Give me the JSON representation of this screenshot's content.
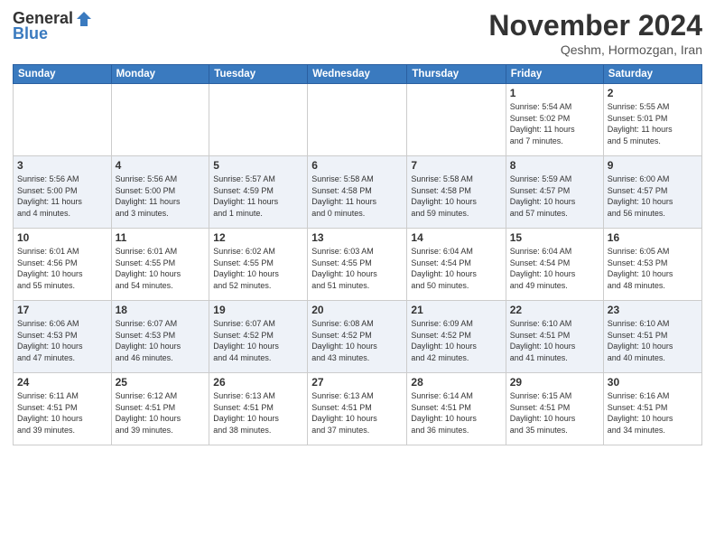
{
  "header": {
    "logo_general": "General",
    "logo_blue": "Blue",
    "title": "November 2024",
    "location": "Qeshm, Hormozgan, Iran"
  },
  "days_of_week": [
    "Sunday",
    "Monday",
    "Tuesday",
    "Wednesday",
    "Thursday",
    "Friday",
    "Saturday"
  ],
  "weeks": [
    [
      {
        "day": "",
        "info": ""
      },
      {
        "day": "",
        "info": ""
      },
      {
        "day": "",
        "info": ""
      },
      {
        "day": "",
        "info": ""
      },
      {
        "day": "",
        "info": ""
      },
      {
        "day": "1",
        "info": "Sunrise: 5:54 AM\nSunset: 5:02 PM\nDaylight: 11 hours\nand 7 minutes."
      },
      {
        "day": "2",
        "info": "Sunrise: 5:55 AM\nSunset: 5:01 PM\nDaylight: 11 hours\nand 5 minutes."
      }
    ],
    [
      {
        "day": "3",
        "info": "Sunrise: 5:56 AM\nSunset: 5:00 PM\nDaylight: 11 hours\nand 4 minutes."
      },
      {
        "day": "4",
        "info": "Sunrise: 5:56 AM\nSunset: 5:00 PM\nDaylight: 11 hours\nand 3 minutes."
      },
      {
        "day": "5",
        "info": "Sunrise: 5:57 AM\nSunset: 4:59 PM\nDaylight: 11 hours\nand 1 minute."
      },
      {
        "day": "6",
        "info": "Sunrise: 5:58 AM\nSunset: 4:58 PM\nDaylight: 11 hours\nand 0 minutes."
      },
      {
        "day": "7",
        "info": "Sunrise: 5:58 AM\nSunset: 4:58 PM\nDaylight: 10 hours\nand 59 minutes."
      },
      {
        "day": "8",
        "info": "Sunrise: 5:59 AM\nSunset: 4:57 PM\nDaylight: 10 hours\nand 57 minutes."
      },
      {
        "day": "9",
        "info": "Sunrise: 6:00 AM\nSunset: 4:57 PM\nDaylight: 10 hours\nand 56 minutes."
      }
    ],
    [
      {
        "day": "10",
        "info": "Sunrise: 6:01 AM\nSunset: 4:56 PM\nDaylight: 10 hours\nand 55 minutes."
      },
      {
        "day": "11",
        "info": "Sunrise: 6:01 AM\nSunset: 4:55 PM\nDaylight: 10 hours\nand 54 minutes."
      },
      {
        "day": "12",
        "info": "Sunrise: 6:02 AM\nSunset: 4:55 PM\nDaylight: 10 hours\nand 52 minutes."
      },
      {
        "day": "13",
        "info": "Sunrise: 6:03 AM\nSunset: 4:55 PM\nDaylight: 10 hours\nand 51 minutes."
      },
      {
        "day": "14",
        "info": "Sunrise: 6:04 AM\nSunset: 4:54 PM\nDaylight: 10 hours\nand 50 minutes."
      },
      {
        "day": "15",
        "info": "Sunrise: 6:04 AM\nSunset: 4:54 PM\nDaylight: 10 hours\nand 49 minutes."
      },
      {
        "day": "16",
        "info": "Sunrise: 6:05 AM\nSunset: 4:53 PM\nDaylight: 10 hours\nand 48 minutes."
      }
    ],
    [
      {
        "day": "17",
        "info": "Sunrise: 6:06 AM\nSunset: 4:53 PM\nDaylight: 10 hours\nand 47 minutes."
      },
      {
        "day": "18",
        "info": "Sunrise: 6:07 AM\nSunset: 4:53 PM\nDaylight: 10 hours\nand 46 minutes."
      },
      {
        "day": "19",
        "info": "Sunrise: 6:07 AM\nSunset: 4:52 PM\nDaylight: 10 hours\nand 44 minutes."
      },
      {
        "day": "20",
        "info": "Sunrise: 6:08 AM\nSunset: 4:52 PM\nDaylight: 10 hours\nand 43 minutes."
      },
      {
        "day": "21",
        "info": "Sunrise: 6:09 AM\nSunset: 4:52 PM\nDaylight: 10 hours\nand 42 minutes."
      },
      {
        "day": "22",
        "info": "Sunrise: 6:10 AM\nSunset: 4:51 PM\nDaylight: 10 hours\nand 41 minutes."
      },
      {
        "day": "23",
        "info": "Sunrise: 6:10 AM\nSunset: 4:51 PM\nDaylight: 10 hours\nand 40 minutes."
      }
    ],
    [
      {
        "day": "24",
        "info": "Sunrise: 6:11 AM\nSunset: 4:51 PM\nDaylight: 10 hours\nand 39 minutes."
      },
      {
        "day": "25",
        "info": "Sunrise: 6:12 AM\nSunset: 4:51 PM\nDaylight: 10 hours\nand 39 minutes."
      },
      {
        "day": "26",
        "info": "Sunrise: 6:13 AM\nSunset: 4:51 PM\nDaylight: 10 hours\nand 38 minutes."
      },
      {
        "day": "27",
        "info": "Sunrise: 6:13 AM\nSunset: 4:51 PM\nDaylight: 10 hours\nand 37 minutes."
      },
      {
        "day": "28",
        "info": "Sunrise: 6:14 AM\nSunset: 4:51 PM\nDaylight: 10 hours\nand 36 minutes."
      },
      {
        "day": "29",
        "info": "Sunrise: 6:15 AM\nSunset: 4:51 PM\nDaylight: 10 hours\nand 35 minutes."
      },
      {
        "day": "30",
        "info": "Sunrise: 6:16 AM\nSunset: 4:51 PM\nDaylight: 10 hours\nand 34 minutes."
      }
    ]
  ]
}
